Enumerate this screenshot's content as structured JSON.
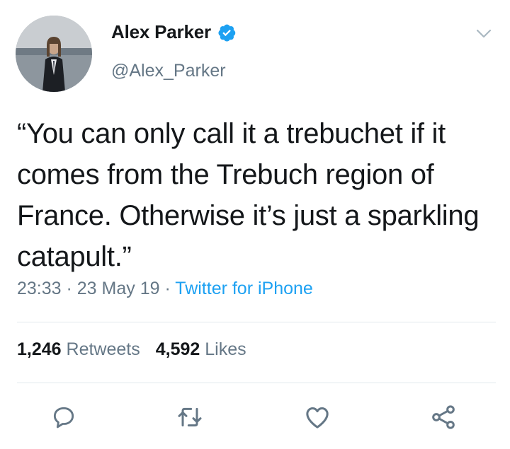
{
  "author": {
    "name": "Alex Parker",
    "handle": "@Alex_Parker",
    "verified": true
  },
  "tweet": {
    "text": "“You can only call it a trebuchet if it comes from the Trebuch region of France. Otherwise it’s just a sparkling catapult.”",
    "time": "23:33",
    "date": "23 May 19",
    "separator": " · ",
    "source": "Twitter for iPhone"
  },
  "stats": {
    "retweets_count": "1,246",
    "retweets_label": "Retweets",
    "likes_count": "4,592",
    "likes_label": "Likes"
  },
  "actions": [
    "reply-icon",
    "retweet-icon",
    "like-icon",
    "share-icon"
  ],
  "colors": {
    "accent": "#1da1f2",
    "text": "#14171a",
    "secondary": "#657786",
    "divider": "#e1e8ed"
  }
}
